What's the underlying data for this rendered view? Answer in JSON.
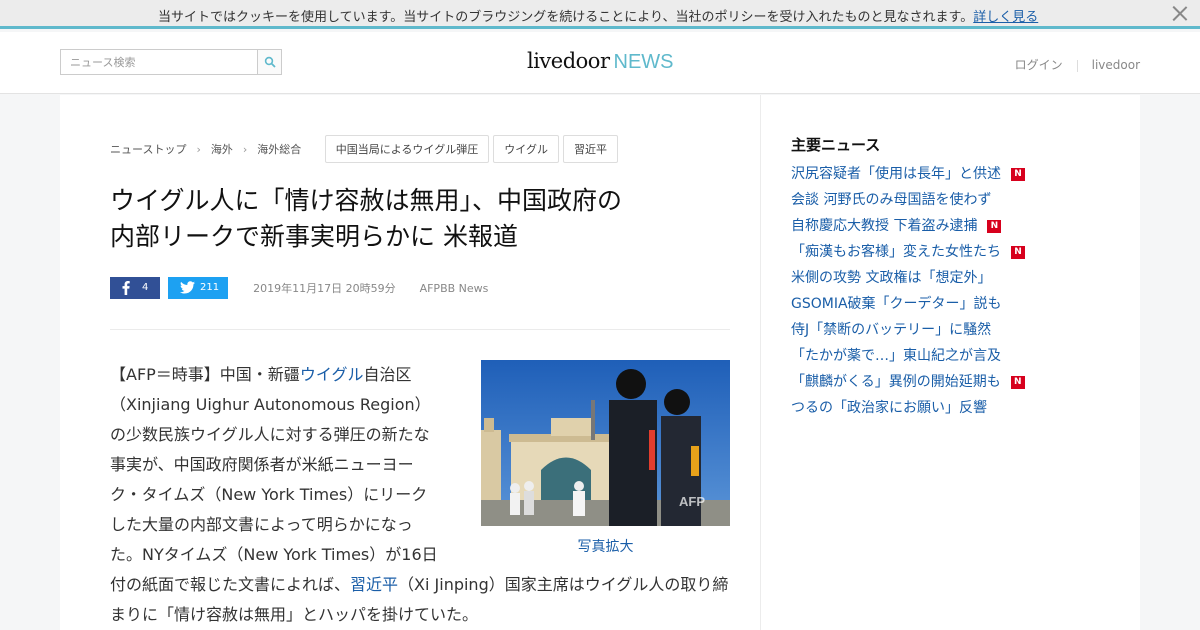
{
  "cookie": {
    "message": "当サイトではクッキーを使用しています。当サイトのブラウジングを続けることにより、当社のポリシーを受け入れたものと見なされます。",
    "link": "詳しく見る"
  },
  "header": {
    "search_placeholder": "ニュース検索",
    "logo_main": "livedoor",
    "logo_sub": "NEWS",
    "login": "ログイン",
    "livedoor_link": "livedoor"
  },
  "breadcrumb": [
    "ニューストップ",
    "海外",
    "海外総合"
  ],
  "tags": [
    "中国当局によるウイグル弾圧",
    "ウイグル",
    "習近平"
  ],
  "article": {
    "title_line1": "ウイグル人に「情け容赦は無用」、中国政府の",
    "title_line2": "内部リークで新事実明らかに 米報道",
    "fb_count": "4",
    "tw_count": "211",
    "date": "2019年11月17日 20時59分",
    "source": "AFPBB News",
    "photo_caption": "写真拡大",
    "photo_watermark": "AFP",
    "body": {
      "p1a": "【AFP＝時事】中国・新疆",
      "link1": "ウイグル",
      "p1b": "自治区（Xinjiang Uighur Autonomous Region）の少数民族ウイグル人に対する弾圧の新たな事実が、中国政府関係者が米紙ニューヨーク・タイムズ（New York Times）にリークした大量の内部文書によって明らかになった。NYタイムズ（New York Times）が16日付の紙面で報じた文書によれば、",
      "link2": "習近平",
      "p1c": "（Xi Jinping）国家主席はウイグル人の取り締まりに「情け容赦は無用」とハッパを掛けていた。"
    }
  },
  "sidebar": {
    "heading": "主要ニュース",
    "new_badge": "N",
    "items": [
      {
        "label": "沢尻容疑者「使用は長年」と供述",
        "is_new": true
      },
      {
        "label": "会談 河野氏のみ母国語を使わず",
        "is_new": false
      },
      {
        "label": "自称慶応大教授 下着盗み逮捕",
        "is_new": true
      },
      {
        "label": "「痴漢もお客様」変えた女性たち",
        "is_new": true
      },
      {
        "label": "米側の攻勢 文政権は「想定外」",
        "is_new": false
      },
      {
        "label": "GSOMIA破棄「クーデター」説も",
        "is_new": false
      },
      {
        "label": "侍J「禁断のバッテリー」に騒然",
        "is_new": false
      },
      {
        "label": "「たかが薬で…」東山紀之が言及",
        "is_new": false
      },
      {
        "label": "「麒麟がくる」異例の開始延期も",
        "is_new": true
      },
      {
        "label": "つるの「政治家にお願い」反響",
        "is_new": false
      }
    ]
  },
  "colors": {
    "accent": "#5fb9cc",
    "link": "#1a5ea8",
    "facebook": "#315096",
    "twitter": "#1da1f2",
    "new_badge": "#d7001d"
  }
}
